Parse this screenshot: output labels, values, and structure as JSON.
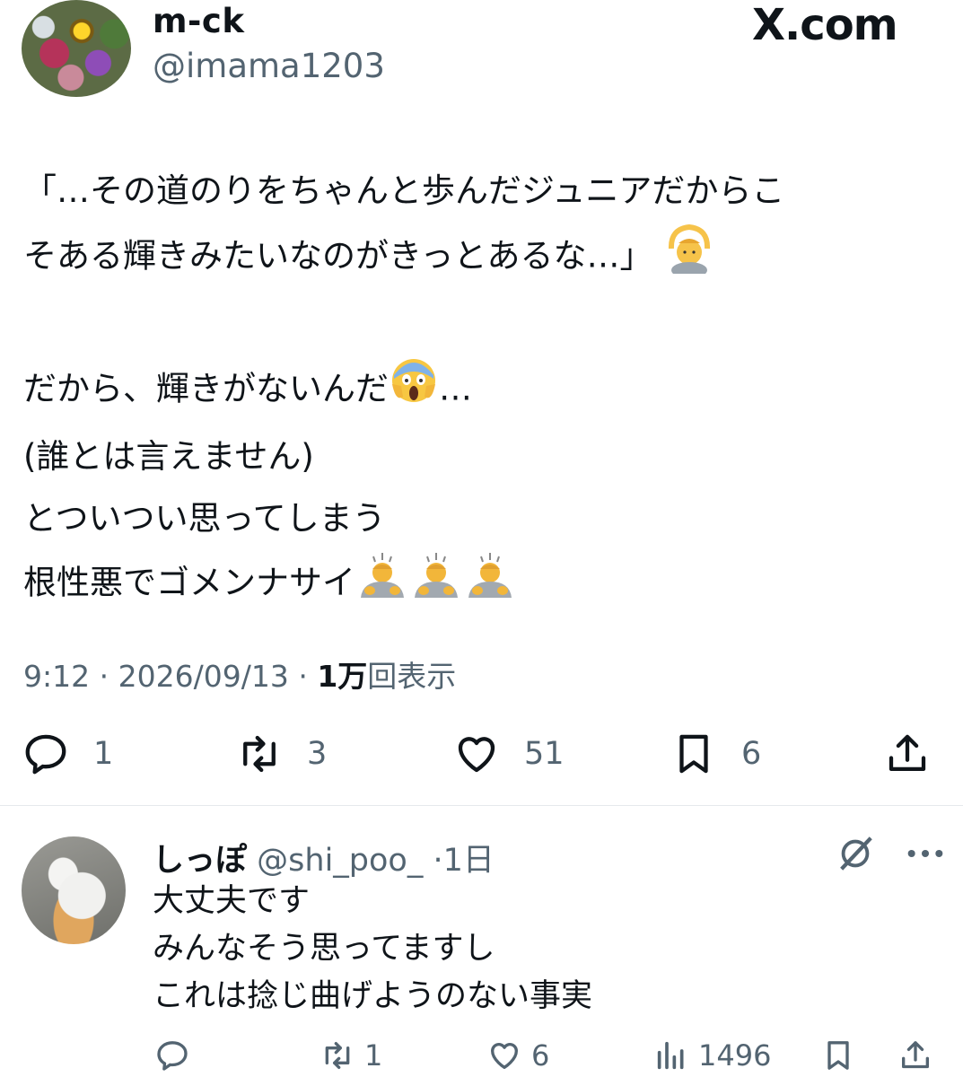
{
  "post": {
    "author_name": "m-ck",
    "author_handle": "@imama1203",
    "site_logo": "X.com",
    "text_lines": [
      "「…その道のりをちゃんと歩んだジュニアだからこ",
      "そある輝きみたいなのがきっとあるな…」",
      "",
      "だから、輝きがないんだ",
      "(誰とは言えません)",
      "とついつい思ってしまう",
      "根性悪でゴメンナサイ"
    ],
    "line4_suffix": "…",
    "time": "9:12",
    "date": "2026/09/13",
    "views_count": "1万",
    "views_label": "回表示",
    "separator": "·",
    "stats": {
      "replies": "1",
      "reposts": "3",
      "likes": "51",
      "bookmarks": "6"
    }
  },
  "reply": {
    "author_name": "しっぽ",
    "author_handle": "@shi_poo_",
    "age": "1日",
    "separator": "·",
    "text_lines": [
      "大丈夫です",
      "みんなそう思ってますし",
      "これは捻じ曲げようのない事実"
    ],
    "stats": {
      "replies": "",
      "reposts": "1",
      "likes": "6",
      "views": "1496"
    }
  },
  "icons": [
    "reply-icon",
    "repost-icon",
    "like-icon",
    "bookmark-icon",
    "share-icon",
    "views-icon",
    "grok-icon",
    "more-icon",
    "person-gesturing-ok-emoji",
    "face-screaming-emoji",
    "person-bowing-emoji"
  ],
  "colors": {
    "text": "#0f1419",
    "secondary": "#536471",
    "divider": "#e6e9ec"
  }
}
